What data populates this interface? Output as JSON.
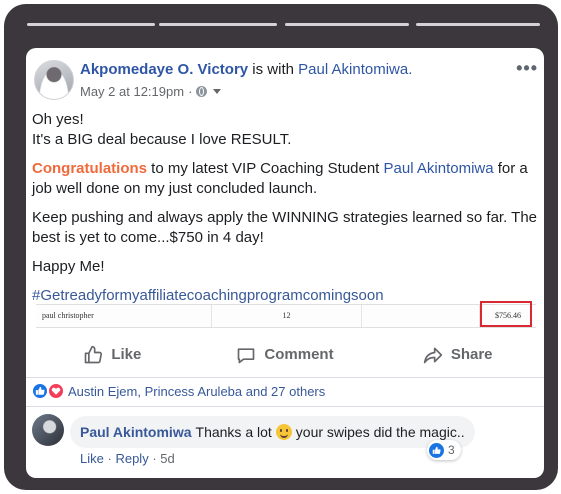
{
  "post": {
    "author": "Akpomedaye O. Victory",
    "with_text": "is with",
    "tagged": "Paul Akintomiwa.",
    "timestamp": "May 2 at 12:19pm",
    "separator": "·",
    "more_label": "•••",
    "lines": {
      "l1": "Oh yes!",
      "l2": "It's a BIG deal because I love RESULT.",
      "congrats": "Congratulations",
      "congrats_rest1": " to my latest VIP Coaching Student ",
      "student": "Paul Akintomiwa",
      "congrats_rest2": " for a job well done on my just concluded launch.",
      "l4": "Keep pushing and always apply the WINNING strategies learned so far. The best is yet to come...$750 in 4 day!",
      "l5": "Happy Me!",
      "hashtag": "#Getreadyformyaffiliatecoachingprogramcomingsoon"
    }
  },
  "attachment": {
    "name": "paul christopher",
    "count": "12",
    "amount": "$756.46"
  },
  "actions": {
    "like": "Like",
    "comment": "Comment",
    "share": "Share"
  },
  "reactions": {
    "summary": "Austin Ejem, Princess Aruleba and 27 others"
  },
  "comment": {
    "author": "Paul Akintomiwa",
    "text_before": "Thanks a lot",
    "text_after": "your swipes did the magic..",
    "reaction_count": "3",
    "like_link": "Like",
    "reply_link": "Reply",
    "sep": "·",
    "age": "5d"
  },
  "colors": {
    "frame": "#3b373d",
    "link_blue": "#385898",
    "congrats_orange": "#f06a3c",
    "highlight_red": "#d9282f"
  }
}
